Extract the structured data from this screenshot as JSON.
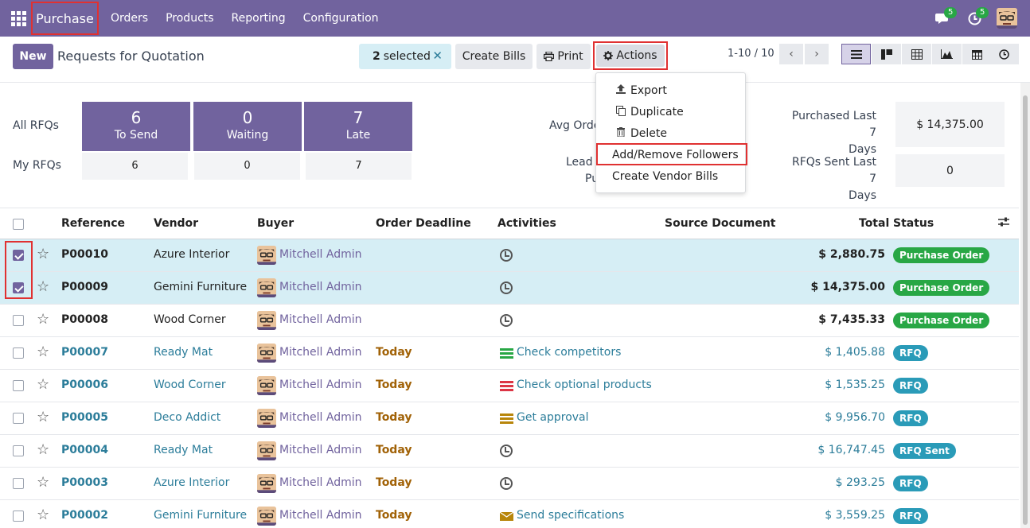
{
  "navbar": {
    "app_name": "Purchase",
    "menu": [
      "Orders",
      "Products",
      "Reporting",
      "Configuration"
    ],
    "messages_count": "5",
    "activities_count": "5"
  },
  "control": {
    "new_label": "New",
    "title": "Requests for Quotation",
    "selected_count": "2",
    "selected_label": "selected",
    "create_bills": "Create Bills",
    "print": "Print",
    "actions": "Actions",
    "pager": "1-10 / 10"
  },
  "dropdown": {
    "items": [
      "Export",
      "Duplicate",
      "Delete",
      "Add/Remove Followers",
      "Create Vendor Bills"
    ]
  },
  "dashboard": {
    "all_rfqs": "All RFQs",
    "my_rfqs": "My RFQs",
    "tiles": [
      {
        "num": "6",
        "label": "To Send",
        "mine": "6"
      },
      {
        "num": "0",
        "label": "Waiting",
        "mine": "0"
      },
      {
        "num": "7",
        "label": "Late",
        "mine": "7"
      }
    ],
    "avg_order_partial": "Avg Orde",
    "lead_partial": "Lead T",
    "pu_partial": "Pu",
    "purchased_last_7_line1": "Purchased Last 7",
    "purchased_last_7_line2": "Days",
    "purchased_last_7_value": "$ 14,375.00",
    "rfqs_sent_line1": "RFQs Sent Last 7",
    "rfqs_sent_line2": "Days",
    "rfqs_sent_value": "0"
  },
  "table": {
    "headers": {
      "reference": "Reference",
      "vendor": "Vendor",
      "buyer": "Buyer",
      "deadline": "Order Deadline",
      "activities": "Activities",
      "source": "Source Document",
      "total": "Total",
      "status": "Status"
    },
    "rows": [
      {
        "ref": "P00010",
        "vendor": "Azure Interior",
        "buyer": "Mitchell Admin",
        "deadline": "",
        "activity": "",
        "total": "$ 2,880.75",
        "status": "Purchase Order"
      },
      {
        "ref": "P00009",
        "vendor": "Gemini Furniture",
        "buyer": "Mitchell Admin",
        "deadline": "",
        "activity": "",
        "total": "$ 14,375.00",
        "status": "Purchase Order"
      },
      {
        "ref": "P00008",
        "vendor": "Wood Corner",
        "buyer": "Mitchell Admin",
        "deadline": "",
        "activity": "",
        "total": "$ 7,435.33",
        "status": "Purchase Order"
      },
      {
        "ref": "P00007",
        "vendor": "Ready Mat",
        "buyer": "Mitchell Admin",
        "deadline": "Today",
        "activity": "Check competitors",
        "total": "$ 1,405.88",
        "status": "RFQ"
      },
      {
        "ref": "P00006",
        "vendor": "Wood Corner",
        "buyer": "Mitchell Admin",
        "deadline": "Today",
        "activity": "Check optional products",
        "total": "$ 1,535.25",
        "status": "RFQ"
      },
      {
        "ref": "P00005",
        "vendor": "Deco Addict",
        "buyer": "Mitchell Admin",
        "deadline": "Today",
        "activity": "Get approval",
        "total": "$ 9,956.70",
        "status": "RFQ"
      },
      {
        "ref": "P00004",
        "vendor": "Ready Mat",
        "buyer": "Mitchell Admin",
        "deadline": "Today",
        "activity": "",
        "total": "$ 16,747.45",
        "status": "RFQ Sent"
      },
      {
        "ref": "P00003",
        "vendor": "Azure Interior",
        "buyer": "Mitchell Admin",
        "deadline": "Today",
        "activity": "",
        "total": "$ 293.25",
        "status": "RFQ"
      },
      {
        "ref": "P00002",
        "vendor": "Gemini Furniture",
        "buyer": "Mitchell Admin",
        "deadline": "Today",
        "activity": "Send specifications",
        "total": "$ 3,559.25",
        "status": "RFQ"
      }
    ]
  },
  "colors": {
    "brand": "#71639e",
    "selected_row": "#d6eef5",
    "link": "#2c7d9a",
    "status_po": "#28a745",
    "status_rfq": "#2a9bb8",
    "highlight": "#e03131"
  }
}
